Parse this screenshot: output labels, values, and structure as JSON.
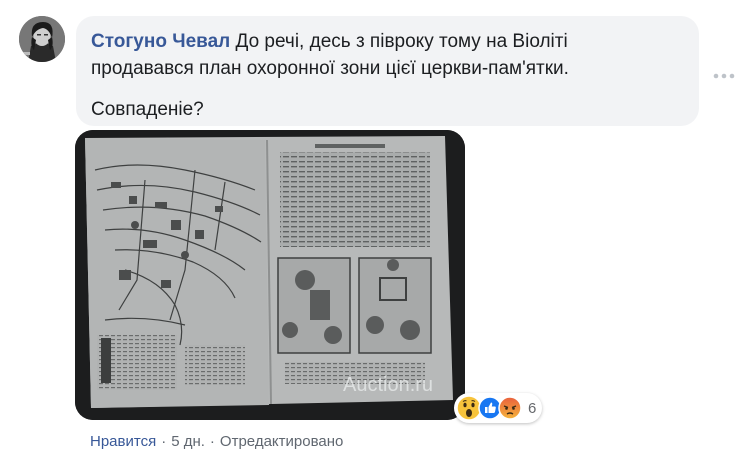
{
  "comment": {
    "author": "Стогуно Чевал",
    "text_line1": "До речі, десь з півроку тому на Віоліті",
    "text_line2": "продавався план охоронної зони цієї церкви-пам'ятки.",
    "text_para2": "Совпаденіе?"
  },
  "photo": {
    "watermark": "Auction.ru"
  },
  "reactions": {
    "icons": [
      "wow-emoji-icon",
      "like-icon",
      "angry-emoji-icon"
    ],
    "count": "6"
  },
  "actions": {
    "like": "Нравится",
    "separator": "·",
    "time": "5 дн.",
    "edited": "Отредактировано"
  },
  "colors": {
    "author": "#385898",
    "bubble_bg": "#f2f3f5",
    "meta_text": "#606770",
    "like_blue": "#1877f2"
  }
}
